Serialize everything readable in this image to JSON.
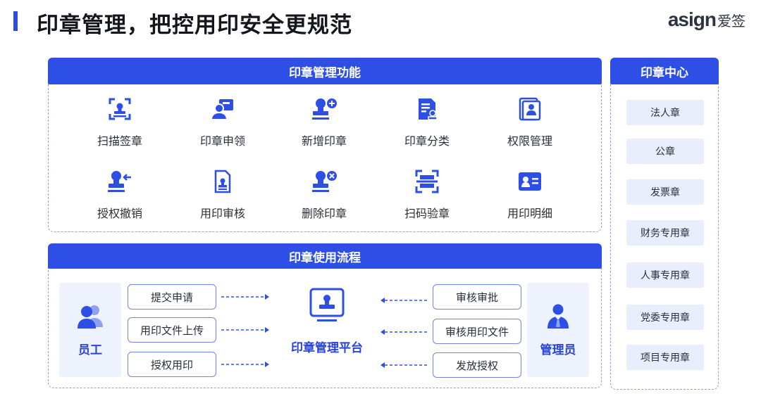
{
  "header": {
    "title": "印章管理，把控用印安全更规范",
    "logo_latin": "asign",
    "logo_cn": "爱签",
    "accent_color": "#2b4de3"
  },
  "functions": {
    "title": "印章管理功能",
    "items": [
      {
        "label": "扫描签章",
        "icon": "scan-seal-icon"
      },
      {
        "label": "印章申领",
        "icon": "seal-apply-icon"
      },
      {
        "label": "新增印章",
        "icon": "add-seal-icon"
      },
      {
        "label": "印章分类",
        "icon": "seal-category-icon"
      },
      {
        "label": "权限管理",
        "icon": "permission-icon"
      },
      {
        "label": "授权撤销",
        "icon": "revoke-icon"
      },
      {
        "label": "用印审核",
        "icon": "review-icon"
      },
      {
        "label": "删除印章",
        "icon": "delete-seal-icon"
      },
      {
        "label": "扫码验章",
        "icon": "qr-verify-icon"
      },
      {
        "label": "用印明细",
        "icon": "detail-icon"
      }
    ]
  },
  "process": {
    "title": "印章使用流程",
    "employee_label": "员工",
    "manager_label": "管理员",
    "platform_label": "印章管理平台",
    "employee_steps": [
      "提交申请",
      "用印文件上传",
      "授权用印"
    ],
    "manager_steps": [
      "审核审批",
      "审核用印文件",
      "发放授权"
    ]
  },
  "seal_center": {
    "title": "印章中心",
    "items": [
      "法人章",
      "公章",
      "发票章",
      "财务专用章",
      "人事专用章",
      "党委专用章",
      "项目专用章"
    ]
  },
  "colors": {
    "primary": "#2d4fe6",
    "light_fill": "#e9eefc"
  }
}
